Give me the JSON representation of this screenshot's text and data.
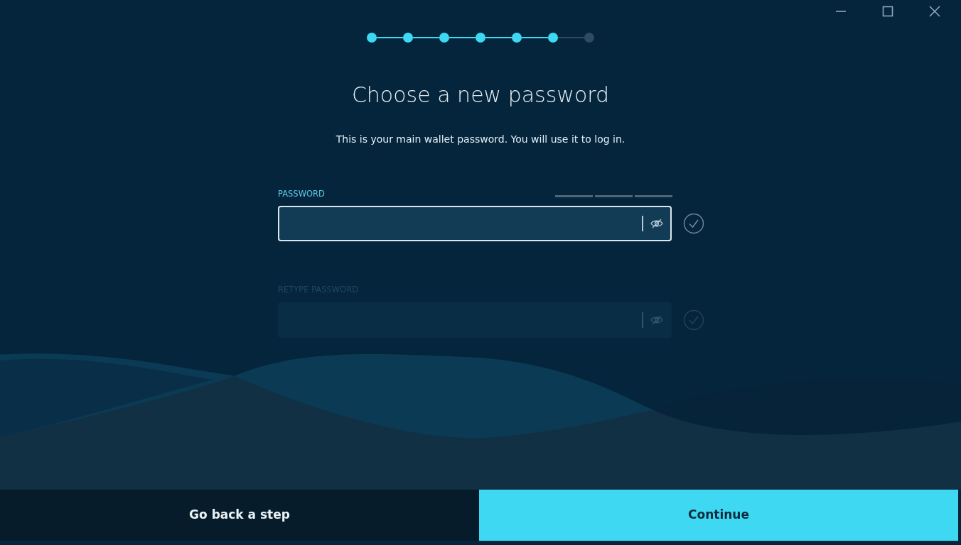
{
  "steps": [
    {
      "done": true
    },
    {
      "done": true
    },
    {
      "done": true
    },
    {
      "done": true
    },
    {
      "done": true
    },
    {
      "done": true
    },
    {
      "done": false
    }
  ],
  "title": "Choose a new password",
  "subtitle": "This is your main wallet password. You will use it to log in.",
  "fields": [
    {
      "label": "PASSWORD",
      "focused": true,
      "disabled": false,
      "strength_meter": true
    },
    {
      "label": "RETYPE PASSWORD",
      "focused": false,
      "disabled": true,
      "strength_meter": false
    }
  ],
  "buttons": [
    {
      "label": "Go back a step",
      "kind": "secondary"
    },
    {
      "label": "Continue",
      "kind": "primary"
    }
  ]
}
